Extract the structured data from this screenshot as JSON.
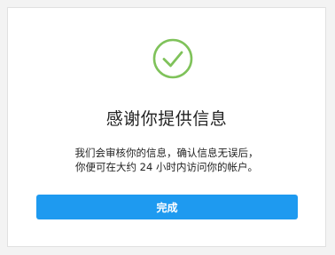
{
  "dialog": {
    "title": "感谢你提供信息",
    "message_line1": "我们会审核你的信息，确认信息无误后，",
    "message_line2": "你便可在大约 24 小时内访问你的帐户。",
    "done_label": "完成",
    "success_icon": "check-circle-icon"
  },
  "colors": {
    "success": "#7fc25a",
    "primary": "#1e9af0"
  }
}
